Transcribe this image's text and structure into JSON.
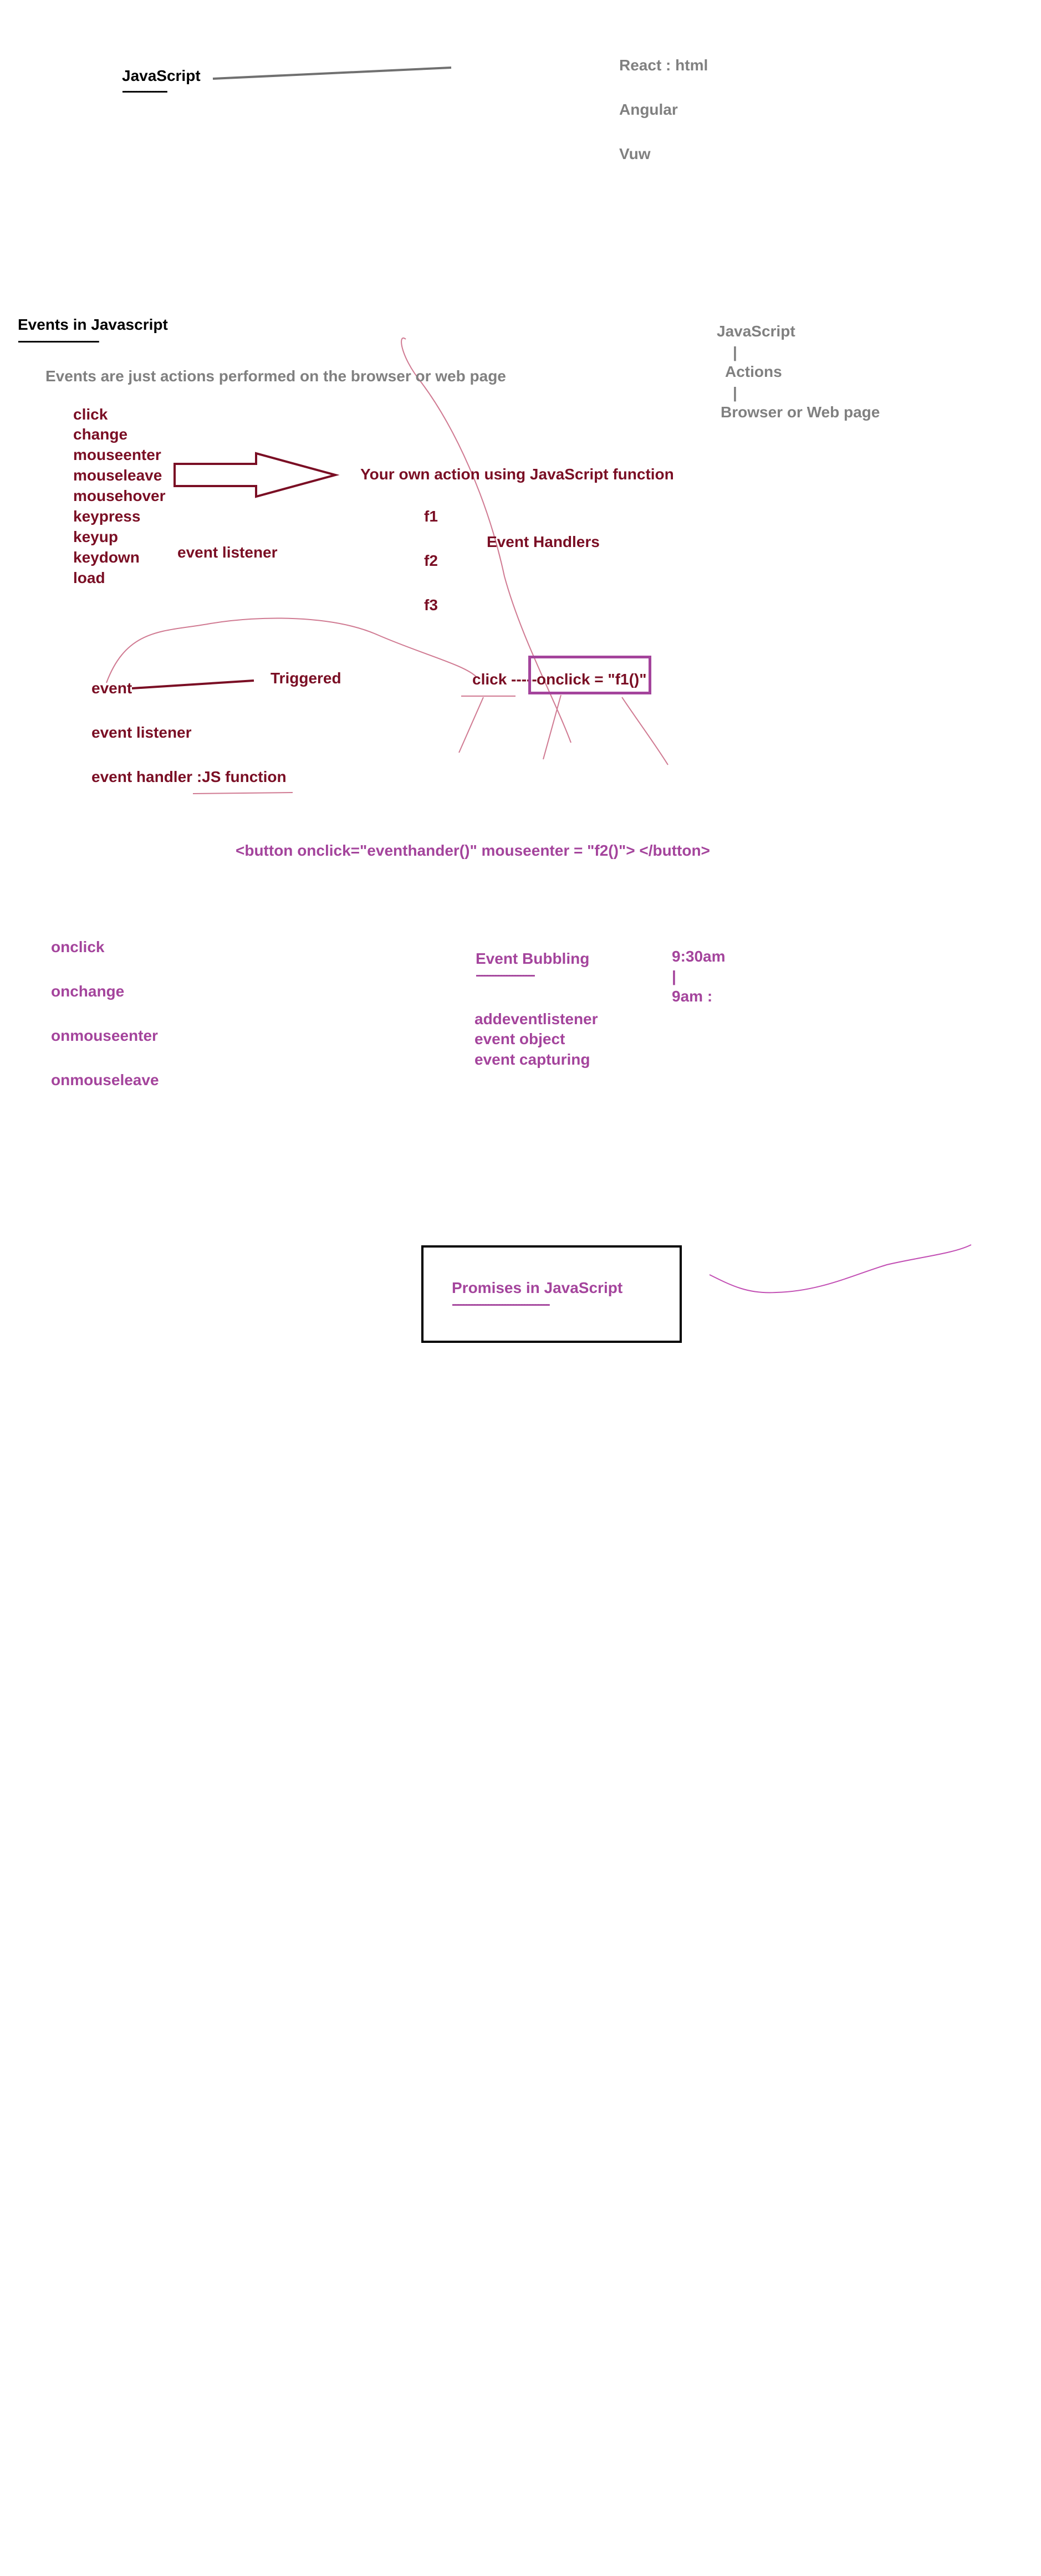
{
  "top_section": {
    "javascript": "JavaScript",
    "underline": "----------------",
    "frameworks": [
      "React : html",
      "Angular",
      "Vuw"
    ]
  },
  "events_section": {
    "title": "Events in Javascript",
    "title_underline": "-----------------------------",
    "definition": "Events are just actions performed on the browser or web page",
    "event_list": [
      "click",
      "change",
      "mouseenter",
      "mouseleave",
      "mousehover",
      "keypress",
      "keyup",
      "keydown",
      "load"
    ],
    "event_listener_label": "event listener",
    "own_action": "Your own action using JavaScript function",
    "functions": [
      "f1",
      "f2",
      "f3"
    ],
    "event_handlers": "Event Handlers",
    "flow": {
      "top": "JavaScript",
      "bar1": "|",
      "middle": "Actions",
      "bar2": "|",
      "bottom": "Browser or Web page"
    }
  },
  "trigger_section": {
    "event": "event",
    "triggered": "Triggered",
    "click_onclick": "click ----- ",
    "onclick_boxed": "onclick = \"f1()\"",
    "event_listener": "event listener",
    "event_handler": "event handler :JS function"
  },
  "code_example": "<button onclick=\"eventhander()\" mouseenter = \"f2()\"> </button>",
  "handlers": [
    "onclick",
    "onchange",
    "onmouseenter",
    "onmouseleave"
  ],
  "bubbling": {
    "title": "Event Bubbling",
    "underline": "---------------------",
    "items": [
      "addeventlistener",
      "event object",
      "event capturing"
    ]
  },
  "time": {
    "start": "9:30am",
    "bar": "|",
    "end": "9am :"
  },
  "promises": {
    "title": "Promises in JavaScript",
    "underline": "-----------------------------------"
  },
  "colors": {
    "black": "#000000",
    "gray": "#808080",
    "maroon": "#7a0e24",
    "purple": "#a4449c"
  }
}
